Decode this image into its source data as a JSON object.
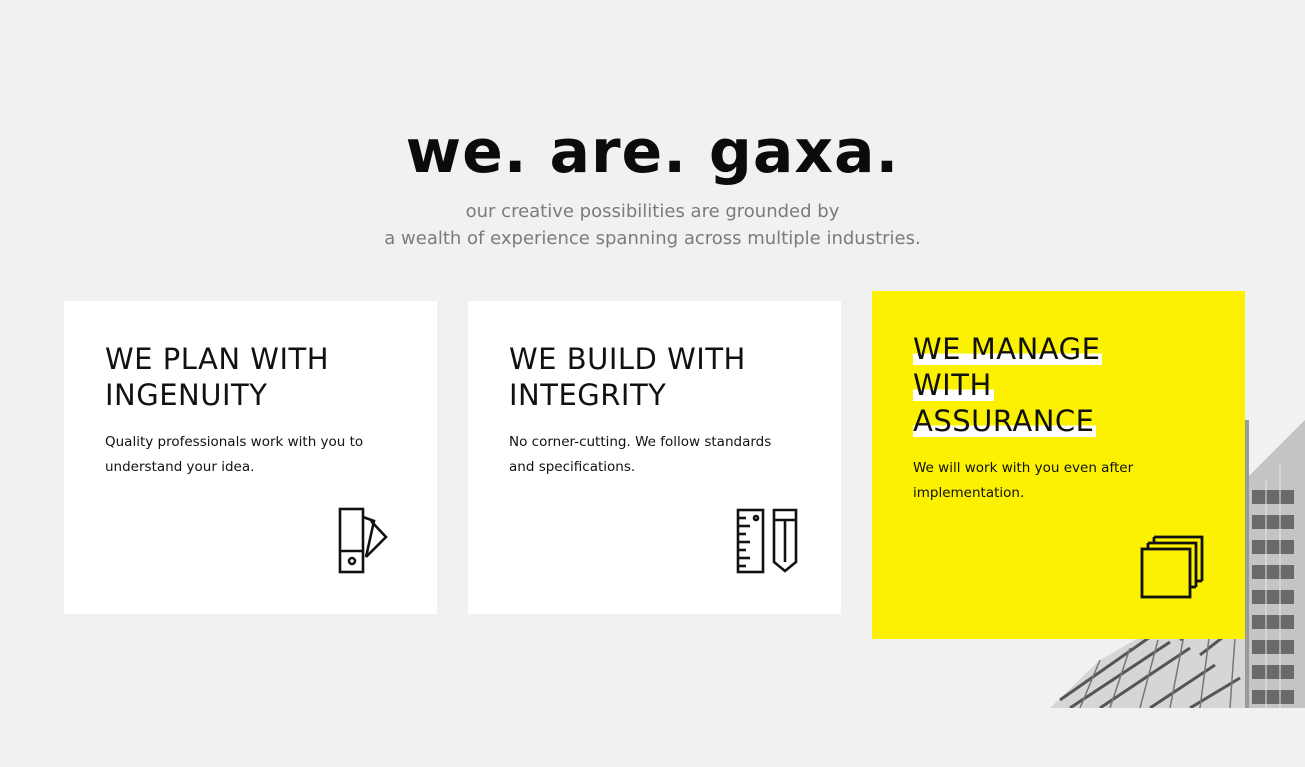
{
  "hero": {
    "title": "we. are. gaxa.",
    "subtitle_line1": "our creative possibilities are grounded by",
    "subtitle_line2": "a wealth of experience spanning across multiple industries."
  },
  "cards": [
    {
      "title_line1": "WE PLAN WITH",
      "title_line2": "INGENUITY",
      "text_line1": "Quality professionals work with you to",
      "text_line2": "understand your idea.",
      "icon": "swatch-icon"
    },
    {
      "title_line1": "WE BUILD WITH",
      "title_line2": "INTEGRITY",
      "text_line1": "No corner-cutting. We follow standards",
      "text_line2": "and specifications.",
      "icon": "ruler-pencil-icon"
    },
    {
      "title_line1": "WE MANAGE",
      "title_line2": "WITH",
      "title_line3": "ASSURANCE",
      "text_line1": "We will work with you even after",
      "text_line2": "implementation.",
      "icon": "stacked-squares-icon",
      "background": "#fbf100"
    }
  ],
  "colors": {
    "page_background": "#f1f1f1",
    "accent_yellow": "#fbf100",
    "subtitle_gray": "#7b7b7b"
  }
}
